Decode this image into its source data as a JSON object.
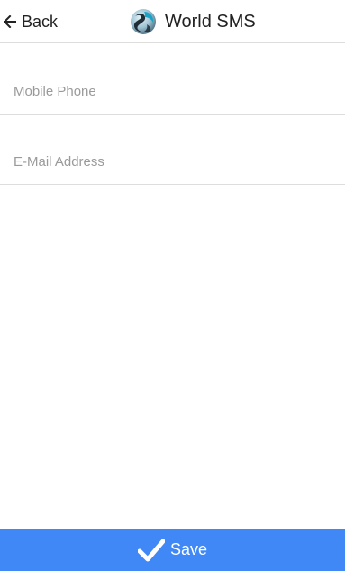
{
  "header": {
    "back_label": "Back",
    "title": "World SMS",
    "back_icon": "arrow-left-icon",
    "logo_icon": "app-logo-icon"
  },
  "form": {
    "mobile_phone": {
      "placeholder": "Mobile Phone",
      "value": ""
    },
    "email": {
      "placeholder": "E-Mail Address",
      "value": ""
    }
  },
  "footer": {
    "save_label": "Save",
    "save_icon": "checkmark-icon"
  },
  "colors": {
    "accent": "#3f88f5",
    "divider": "#dddddd",
    "placeholder": "#9a9a9a",
    "text": "#222222"
  }
}
